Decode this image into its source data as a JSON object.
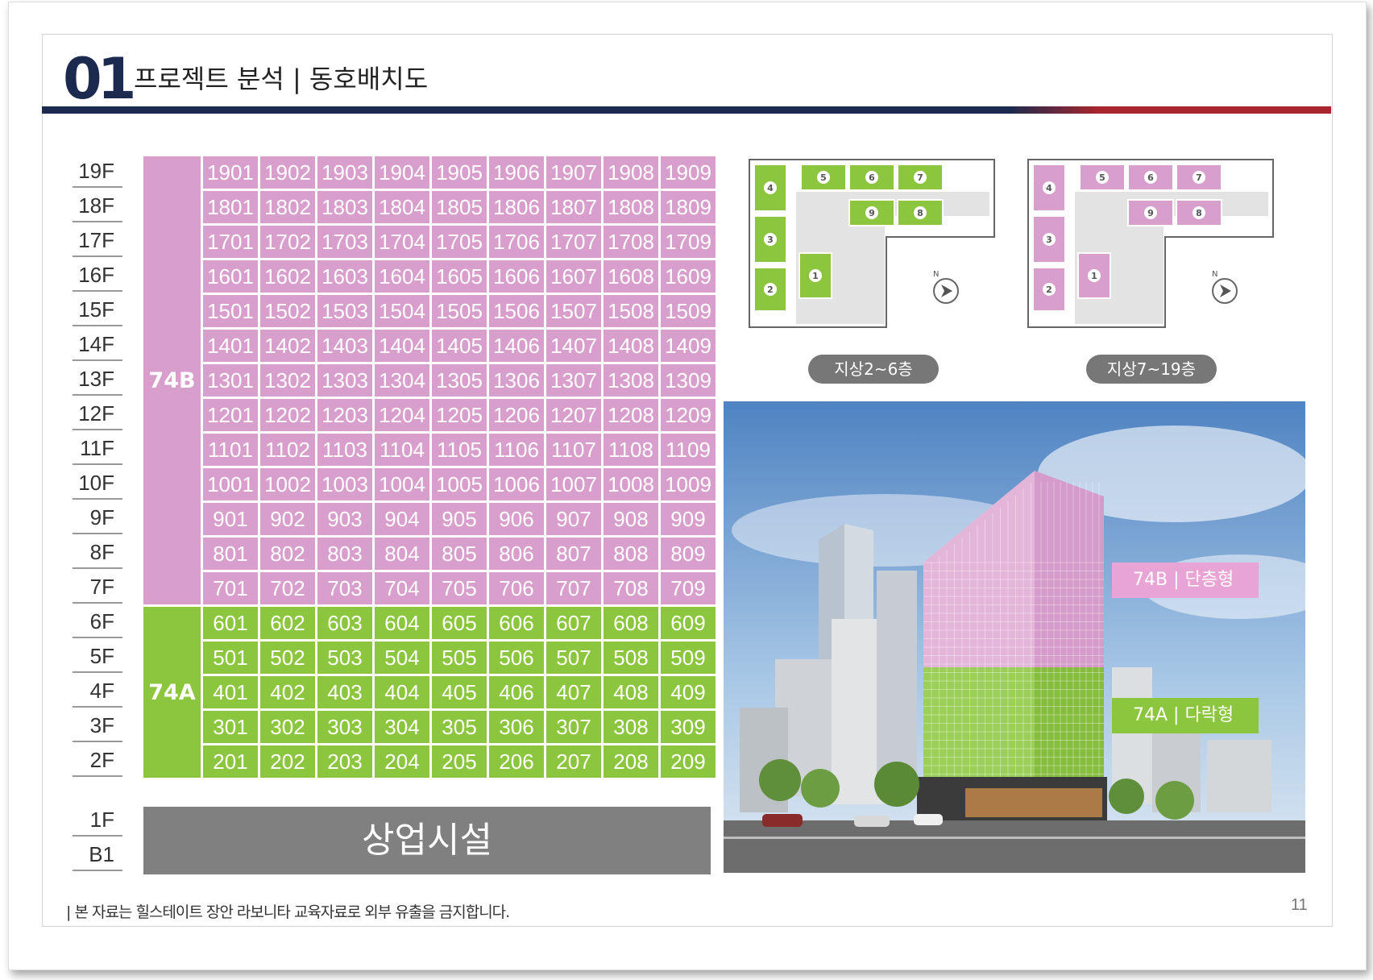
{
  "header": {
    "number": "01",
    "title": "프로젝트 분석 | 동호배치도"
  },
  "floors_upper": [
    "19F",
    "18F",
    "17F",
    "16F",
    "15F",
    "14F",
    "13F",
    "12F",
    "11F",
    "10F",
    "9F",
    "8F",
    "7F",
    "6F",
    "5F",
    "4F",
    "3F",
    "2F"
  ],
  "floors_lower": [
    "1F",
    "B1"
  ],
  "unit_types": {
    "upper": "74B",
    "lower": "74A",
    "upper_color": "#d99fcc",
    "lower_color": "#8cc63f"
  },
  "units": [
    [
      "1901",
      "1902",
      "1903",
      "1904",
      "1905",
      "1906",
      "1907",
      "1908",
      "1909"
    ],
    [
      "1801",
      "1802",
      "1803",
      "1804",
      "1805",
      "1806",
      "1807",
      "1808",
      "1809"
    ],
    [
      "1701",
      "1702",
      "1703",
      "1704",
      "1705",
      "1706",
      "1707",
      "1708",
      "1709"
    ],
    [
      "1601",
      "1602",
      "1603",
      "1604",
      "1605",
      "1606",
      "1607",
      "1608",
      "1609"
    ],
    [
      "1501",
      "1502",
      "1503",
      "1504",
      "1505",
      "1506",
      "1507",
      "1508",
      "1509"
    ],
    [
      "1401",
      "1402",
      "1403",
      "1404",
      "1405",
      "1406",
      "1407",
      "1408",
      "1409"
    ],
    [
      "1301",
      "1302",
      "1303",
      "1304",
      "1305",
      "1306",
      "1307",
      "1308",
      "1309"
    ],
    [
      "1201",
      "1202",
      "1203",
      "1204",
      "1205",
      "1206",
      "1207",
      "1208",
      "1209"
    ],
    [
      "1101",
      "1102",
      "1103",
      "1104",
      "1105",
      "1106",
      "1107",
      "1108",
      "1109"
    ],
    [
      "1001",
      "1002",
      "1003",
      "1004",
      "1005",
      "1006",
      "1007",
      "1008",
      "1009"
    ],
    [
      "901",
      "902",
      "903",
      "904",
      "905",
      "906",
      "907",
      "908",
      "909"
    ],
    [
      "801",
      "802",
      "803",
      "804",
      "805",
      "806",
      "807",
      "808",
      "809"
    ],
    [
      "701",
      "702",
      "703",
      "704",
      "705",
      "706",
      "707",
      "708",
      "709"
    ],
    [
      "601",
      "602",
      "603",
      "604",
      "605",
      "606",
      "607",
      "608",
      "609"
    ],
    [
      "501",
      "502",
      "503",
      "504",
      "505",
      "506",
      "507",
      "508",
      "509"
    ],
    [
      "401",
      "402",
      "403",
      "404",
      "405",
      "406",
      "407",
      "408",
      "409"
    ],
    [
      "301",
      "302",
      "303",
      "304",
      "305",
      "306",
      "307",
      "308",
      "309"
    ],
    [
      "201",
      "202",
      "203",
      "204",
      "205",
      "206",
      "207",
      "208",
      "209"
    ]
  ],
  "commercial_label": "상업시설",
  "plans": [
    {
      "label": "지상2~6층",
      "unit_numbers": [
        "1",
        "2",
        "3",
        "4",
        "5",
        "6",
        "7",
        "8",
        "9"
      ],
      "color": "#8cc63f"
    },
    {
      "label": "지상7~19층",
      "unit_numbers": [
        "1",
        "2",
        "3",
        "4",
        "5",
        "6",
        "7",
        "8",
        "9"
      ],
      "color": "#d99fcc"
    }
  ],
  "compass_letter": "N",
  "photo_tags": [
    {
      "text": "74B | 단층형",
      "color": "#e9a4d6"
    },
    {
      "text": "74A | 다락형",
      "color": "#8cc63f"
    }
  ],
  "footer": {
    "note": "| 본 자료는 힐스테이트 장안 라보니타 교육자료로 외부 유출을 금지합니다.",
    "page": "11"
  }
}
